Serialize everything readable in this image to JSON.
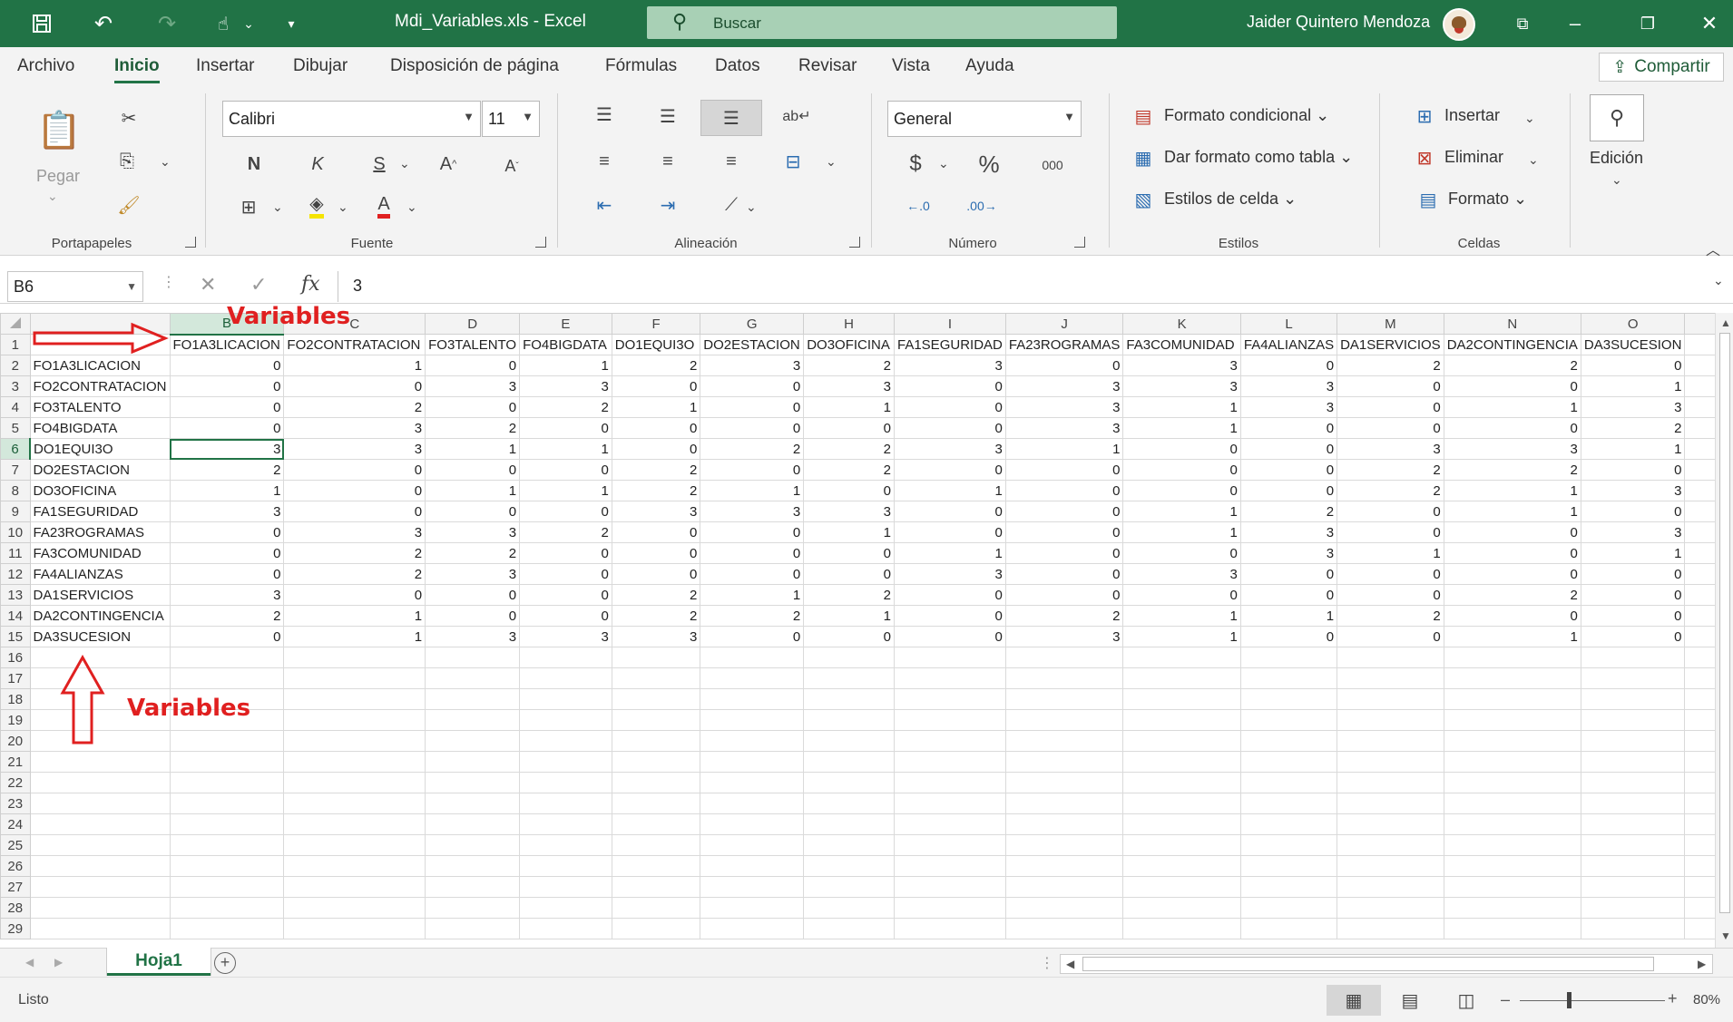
{
  "app": {
    "doc_title": "Mdi_Variables.xls  -  Excel",
    "search_placeholder": "Buscar",
    "user_name": "Jaider Quintero Mendoza"
  },
  "menu": {
    "items": [
      "Archivo",
      "Inicio",
      "Insertar",
      "Dibujar",
      "Disposición de página",
      "Fórmulas",
      "Datos",
      "Revisar",
      "Vista",
      "Ayuda"
    ],
    "active": "Inicio",
    "share_label": "Compartir"
  },
  "ribbon": {
    "portapapeles": {
      "label": "Portapapeles",
      "paste_label": "Pegar"
    },
    "fuente": {
      "label": "Fuente",
      "font_name": "Calibri",
      "font_size": "11",
      "bold": "N",
      "italic": "K",
      "underline": "S"
    },
    "alineacion": {
      "label": "Alineación"
    },
    "numero": {
      "label": "Número",
      "format": "General",
      "currency": "$",
      "percent": "%",
      "thousands": "000"
    },
    "estilos": {
      "label": "Estilos",
      "conditional": "Formato condicional",
      "table_format": "Dar formato como tabla",
      "cell_styles": "Estilos de celda"
    },
    "celdas": {
      "label": "Celdas",
      "insert": "Insertar",
      "delete": "Eliminar",
      "format": "Formato"
    },
    "edicion": {
      "label": "Edición"
    }
  },
  "formula_bar": {
    "name_box": "B6",
    "content": "3"
  },
  "sheet": {
    "columns": [
      "B",
      "C",
      "D",
      "E",
      "F",
      "G",
      "H",
      "I",
      "J",
      "K",
      "L",
      "M",
      "N",
      "O"
    ],
    "header_row": [
      "FO1A3LICACION",
      "FO2CONTRATACION",
      "FO3TALENTO",
      "FO4BIGDATA",
      "DO1EQUI3O",
      "DO2ESTACION",
      "DO3OFICINA",
      "FA1SEGURIDAD",
      "FA23ROGRAMAS",
      "FA3COMUNIDAD",
      "FA4ALIANZAS",
      "DA1SERVICIOS",
      "DA2CONTINGENCIA",
      "DA3SUCESION"
    ],
    "rows": [
      {
        "label": "FO1A3LICACION",
        "values": [
          0,
          1,
          0,
          1,
          2,
          3,
          2,
          3,
          0,
          3,
          0,
          2,
          2,
          0
        ]
      },
      {
        "label": "FO2CONTRATACION",
        "values": [
          0,
          0,
          3,
          3,
          0,
          0,
          3,
          0,
          3,
          3,
          3,
          0,
          0,
          1
        ]
      },
      {
        "label": "FO3TALENTO",
        "values": [
          0,
          2,
          0,
          2,
          1,
          0,
          1,
          0,
          3,
          1,
          3,
          0,
          1,
          3
        ]
      },
      {
        "label": "FO4BIGDATA",
        "values": [
          0,
          3,
          2,
          0,
          0,
          0,
          0,
          0,
          3,
          1,
          0,
          0,
          0,
          2
        ]
      },
      {
        "label": "DO1EQUI3O",
        "values": [
          3,
          3,
          1,
          1,
          0,
          2,
          2,
          3,
          1,
          0,
          0,
          3,
          3,
          1
        ]
      },
      {
        "label": "DO2ESTACION",
        "values": [
          2,
          0,
          0,
          0,
          2,
          0,
          2,
          0,
          0,
          0,
          0,
          2,
          2,
          0
        ]
      },
      {
        "label": "DO3OFICINA",
        "values": [
          1,
          0,
          1,
          1,
          2,
          1,
          0,
          1,
          0,
          0,
          0,
          2,
          1,
          3
        ]
      },
      {
        "label": "FA1SEGURIDAD",
        "values": [
          3,
          0,
          0,
          0,
          3,
          3,
          3,
          0,
          0,
          1,
          2,
          0,
          1,
          0
        ]
      },
      {
        "label": "FA23ROGRAMAS",
        "values": [
          0,
          3,
          3,
          2,
          0,
          0,
          1,
          0,
          0,
          1,
          3,
          0,
          0,
          3
        ]
      },
      {
        "label": "FA3COMUNIDAD",
        "values": [
          0,
          2,
          2,
          0,
          0,
          0,
          0,
          1,
          0,
          0,
          3,
          1,
          0,
          1
        ]
      },
      {
        "label": "FA4ALIANZAS",
        "values": [
          0,
          2,
          3,
          0,
          0,
          0,
          0,
          3,
          0,
          3,
          0,
          0,
          0,
          0
        ]
      },
      {
        "label": "DA1SERVICIOS",
        "values": [
          3,
          0,
          0,
          0,
          2,
          1,
          2,
          0,
          0,
          0,
          0,
          0,
          2,
          0
        ]
      },
      {
        "label": "DA2CONTINGENCIA",
        "values": [
          2,
          1,
          0,
          0,
          2,
          2,
          1,
          0,
          2,
          1,
          1,
          2,
          0,
          0
        ]
      },
      {
        "label": "DA3SUCESION",
        "values": [
          0,
          1,
          3,
          3,
          3,
          0,
          0,
          0,
          3,
          1,
          0,
          0,
          1,
          0
        ]
      }
    ],
    "active_cell": "B6",
    "annotation_top": "Variables",
    "annotation_left": "Variables"
  },
  "tabs": {
    "sheet_name": "Hoja1"
  },
  "status": {
    "text": "Listo",
    "zoom": "80%"
  }
}
